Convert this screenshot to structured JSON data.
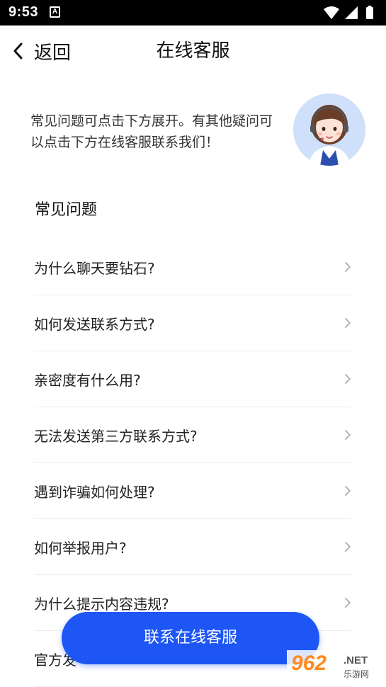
{
  "status_bar": {
    "time": "9:53",
    "notification_icon_letter": "A",
    "icons": [
      "wifi-icon",
      "signal-icon",
      "battery-icon"
    ]
  },
  "nav": {
    "back_label": "返回",
    "title": "在线客服"
  },
  "intro": {
    "text": "常见问题可点击下方展开。有其他疑问可以点击下方在线客服联系我们！",
    "avatar_icon": "customer-service-agent-avatar"
  },
  "faq": {
    "heading": "常见问题",
    "items": [
      {
        "question": "为什么聊天要钻石?"
      },
      {
        "question": "如何发送联系方式?"
      },
      {
        "question": "亲密度有什么用?"
      },
      {
        "question": "无法发送第三方联系方式?"
      },
      {
        "question": "遇到诈骗如何处理?"
      },
      {
        "question": "如何举报用户?"
      },
      {
        "question": "为什么提示内容违规?"
      },
      {
        "question": "官方发"
      }
    ]
  },
  "contact_button": {
    "label": "联系在线客服"
  },
  "watermark": {
    "number": "962",
    "net": ".NET",
    "sub": "乐游网"
  },
  "colors": {
    "accent": "#1e56f5",
    "status_bar": "#000000",
    "avatar_bg": "#cfe0fb"
  }
}
